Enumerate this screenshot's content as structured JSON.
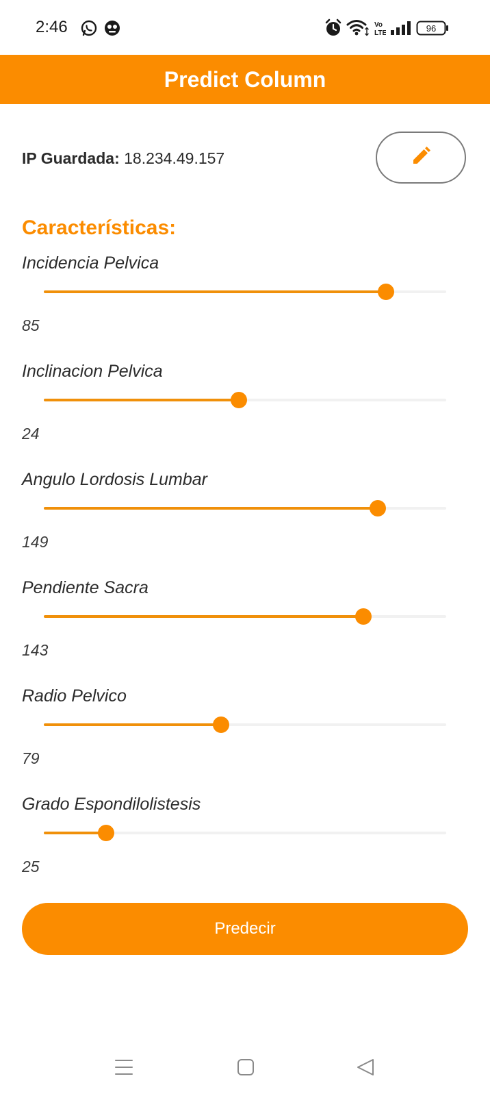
{
  "status_bar": {
    "time": "2:46",
    "battery": "96",
    "icons": [
      "whatsapp-icon",
      "app-notification-icon",
      "alarm-icon",
      "wifi-icon",
      "volte-icon",
      "signal-icon",
      "battery-icon"
    ]
  },
  "app_bar": {
    "title": "Predict Column",
    "color": "#fb8c00"
  },
  "ip": {
    "label": "IP Guardada:",
    "value": "18.234.49.157",
    "edit_icon": "pencil-icon"
  },
  "section_title": "Características:",
  "features": [
    {
      "label": "Incidencia Pelvica",
      "value": "85",
      "fill": 0.85
    },
    {
      "label": "Inclinacion Pelvica",
      "value": "24",
      "fill": 0.485
    },
    {
      "label": "Angulo Lordosis Lumbar",
      "value": "149",
      "fill": 0.83
    },
    {
      "label": "Pendiente Sacra",
      "value": "143",
      "fill": 0.795
    },
    {
      "label": "Radio Pelvico",
      "value": "79",
      "fill": 0.44
    },
    {
      "label": "Grado Espondilolistesis",
      "value": "25",
      "fill": 0.155
    }
  ],
  "predict_button": {
    "label": "Predecir"
  },
  "nav": {
    "icons": [
      "menu-icon",
      "home-square-icon",
      "back-triangle-icon"
    ]
  },
  "colors": {
    "accent": "#fb8c00",
    "track": "#f1f1f1",
    "text": "#2b2b2b"
  }
}
